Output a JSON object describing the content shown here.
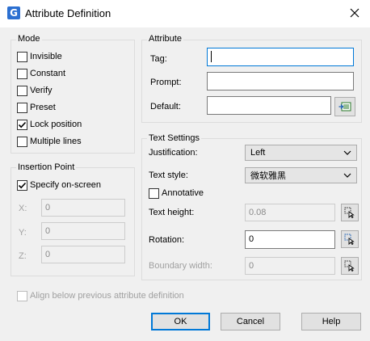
{
  "window": {
    "title": "Attribute Definition",
    "icon": "app-logo-icon"
  },
  "mode": {
    "title": "Mode",
    "options": [
      {
        "label": "Invisible",
        "checked": false
      },
      {
        "label": "Constant",
        "checked": false
      },
      {
        "label": "Verify",
        "checked": false
      },
      {
        "label": "Preset",
        "checked": false
      },
      {
        "label": "Lock position",
        "checked": true
      },
      {
        "label": "Multiple lines",
        "checked": false
      }
    ]
  },
  "insertion": {
    "title": "Insertion Point",
    "specify_label": "Specify on-screen",
    "specify_checked": true,
    "x_label": "X:",
    "x_value": "0",
    "y_label": "Y:",
    "y_value": "0",
    "z_label": "Z:",
    "z_value": "0"
  },
  "attribute": {
    "title": "Attribute",
    "tag_label": "Tag:",
    "tag_value": "",
    "prompt_label": "Prompt:",
    "prompt_value": "",
    "default_label": "Default:",
    "default_value": ""
  },
  "text_settings": {
    "title": "Text Settings",
    "justification_label": "Justification:",
    "justification_value": "Left",
    "style_label": "Text style:",
    "style_value": "微软雅黑",
    "annotative_label": "Annotative",
    "annotative_checked": false,
    "height_label": "Text height:",
    "height_value": "0.08",
    "rotation_label": "Rotation:",
    "rotation_value": "0",
    "boundary_label": "Boundary width:",
    "boundary_value": "0"
  },
  "align_label": "Align below previous attribute definition",
  "buttons": {
    "ok": "OK",
    "cancel": "Cancel",
    "help": "Help"
  }
}
